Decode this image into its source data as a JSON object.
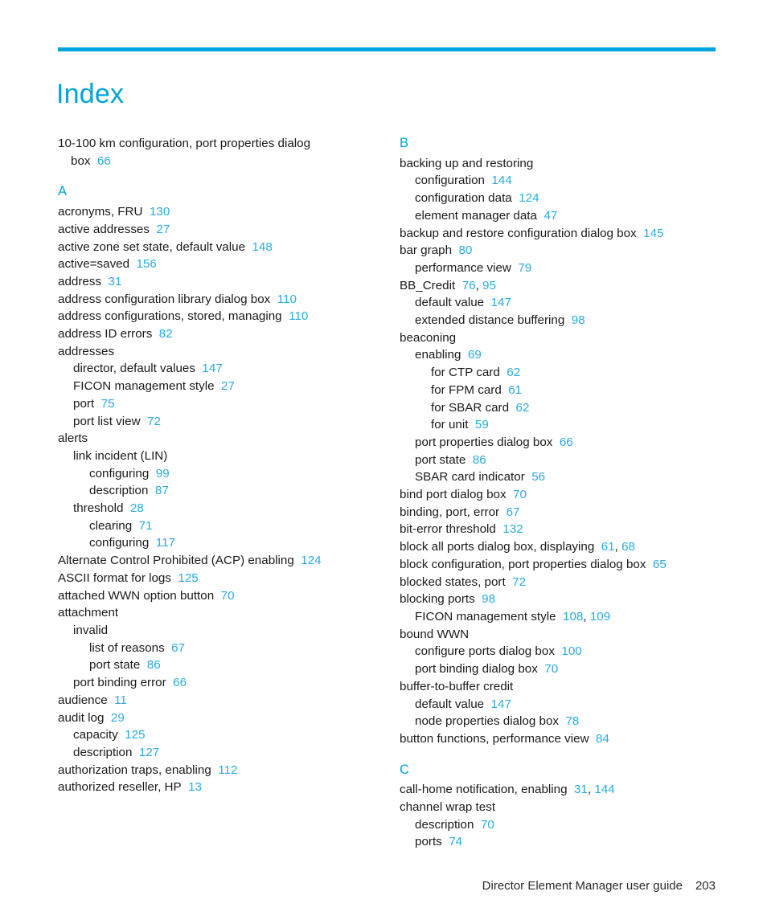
{
  "document": {
    "title": "Index",
    "accent_color": "#00A3DE",
    "page_number_color": "#29ABE2",
    "text_color": "#1a1a1a"
  },
  "footer": {
    "guide_title": "Director Element Manager user guide",
    "folio": "203"
  },
  "columns": [
    {
      "name": "left-column",
      "blocks": [
        {
          "type": "entries",
          "letter": null,
          "entries": [
            {
              "level": 0,
              "text": "10-100 km configuration, port properties dialog",
              "pages": ""
            },
            {
              "level": 0,
              "continuation": true,
              "text": "box",
              "pages": "66"
            }
          ]
        },
        {
          "type": "entries",
          "letter": "A",
          "entries": [
            {
              "level": 0,
              "text": "acronyms, FRU",
              "pages": "130"
            },
            {
              "level": 0,
              "text": "active addresses",
              "pages": "27"
            },
            {
              "level": 0,
              "text": "active zone set state, default value",
              "pages": "148"
            },
            {
              "level": 0,
              "text": "active=saved",
              "pages": "156"
            },
            {
              "level": 0,
              "text": "address",
              "pages": "31"
            },
            {
              "level": 0,
              "text": "address configuration library dialog box",
              "pages": "110"
            },
            {
              "level": 0,
              "text": "address configurations, stored, managing",
              "pages": "110"
            },
            {
              "level": 0,
              "text": "address ID errors",
              "pages": "82"
            },
            {
              "level": 0,
              "text": "addresses",
              "pages": ""
            },
            {
              "level": 1,
              "text": "director, default values",
              "pages": "147"
            },
            {
              "level": 1,
              "text": "FICON management style",
              "pages": "27"
            },
            {
              "level": 1,
              "text": "port",
              "pages": "75"
            },
            {
              "level": 1,
              "text": "port list view",
              "pages": "72"
            },
            {
              "level": 0,
              "text": "alerts",
              "pages": ""
            },
            {
              "level": 1,
              "text": "link incident (LIN)",
              "pages": ""
            },
            {
              "level": 2,
              "text": "configuring",
              "pages": "99"
            },
            {
              "level": 2,
              "text": "description",
              "pages": "87"
            },
            {
              "level": 1,
              "text": "threshold",
              "pages": "28"
            },
            {
              "level": 2,
              "text": "clearing",
              "pages": "71"
            },
            {
              "level": 2,
              "text": "configuring",
              "pages": "117"
            },
            {
              "level": 0,
              "text": "Alternate Control Prohibited (ACP) enabling",
              "pages": "124"
            },
            {
              "level": 0,
              "text": "ASCII format for logs",
              "pages": "125"
            },
            {
              "level": 0,
              "text": "attached WWN option button",
              "pages": "70"
            },
            {
              "level": 0,
              "text": "attachment",
              "pages": ""
            },
            {
              "level": 1,
              "text": "invalid",
              "pages": ""
            },
            {
              "level": 2,
              "text": "list of reasons",
              "pages": "67"
            },
            {
              "level": 2,
              "text": "port state",
              "pages": "86"
            },
            {
              "level": 1,
              "text": "port binding error",
              "pages": "66"
            },
            {
              "level": 0,
              "text": "audience",
              "pages": "11"
            },
            {
              "level": 0,
              "text": "audit log",
              "pages": "29"
            },
            {
              "level": 1,
              "text": "capacity",
              "pages": "125"
            },
            {
              "level": 1,
              "text": "description",
              "pages": "127"
            },
            {
              "level": 0,
              "text": "authorization traps, enabling",
              "pages": "112"
            },
            {
              "level": 0,
              "text": "authorized reseller, HP",
              "pages": "13"
            }
          ]
        }
      ]
    },
    {
      "name": "right-column",
      "blocks": [
        {
          "type": "entries",
          "letter": "B",
          "entries": [
            {
              "level": 0,
              "text": "backing up and restoring",
              "pages": ""
            },
            {
              "level": 1,
              "text": "configuration",
              "pages": "144"
            },
            {
              "level": 1,
              "text": "configuration data",
              "pages": "124"
            },
            {
              "level": 1,
              "text": "element manager data",
              "pages": "47"
            },
            {
              "level": 0,
              "text": "backup and restore configuration dialog box",
              "pages": "145"
            },
            {
              "level": 0,
              "text": "bar graph",
              "pages": "80"
            },
            {
              "level": 1,
              "text": "performance view",
              "pages": "79"
            },
            {
              "level": 0,
              "text": "BB_Credit",
              "pages": "76, 95"
            },
            {
              "level": 1,
              "text": "default value",
              "pages": "147"
            },
            {
              "level": 1,
              "text": "extended distance buffering",
              "pages": "98"
            },
            {
              "level": 0,
              "text": "beaconing",
              "pages": ""
            },
            {
              "level": 1,
              "text": "enabling",
              "pages": "69"
            },
            {
              "level": 2,
              "text": "for CTP card",
              "pages": "62"
            },
            {
              "level": 2,
              "text": "for FPM card",
              "pages": "61"
            },
            {
              "level": 2,
              "text": "for SBAR card",
              "pages": "62"
            },
            {
              "level": 2,
              "text": "for unit",
              "pages": "59"
            },
            {
              "level": 1,
              "text": "port properties dialog box",
              "pages": "66"
            },
            {
              "level": 1,
              "text": "port state",
              "pages": "86"
            },
            {
              "level": 1,
              "text": "SBAR card indicator",
              "pages": "56"
            },
            {
              "level": 0,
              "text": "bind port dialog box",
              "pages": "70"
            },
            {
              "level": 0,
              "text": "binding, port, error",
              "pages": "67"
            },
            {
              "level": 0,
              "text": "bit-error threshold",
              "pages": "132"
            },
            {
              "level": 0,
              "text": "block all ports dialog box, displaying",
              "pages": "61, 68"
            },
            {
              "level": 0,
              "text": "block configuration, port properties dialog box",
              "pages": "65"
            },
            {
              "level": 0,
              "text": "blocked states, port",
              "pages": "72"
            },
            {
              "level": 0,
              "text": "blocking ports",
              "pages": "98"
            },
            {
              "level": 1,
              "text": "FICON management style",
              "pages": "108, 109"
            },
            {
              "level": 0,
              "text": "bound WWN",
              "pages": ""
            },
            {
              "level": 1,
              "text": "configure ports dialog box",
              "pages": "100"
            },
            {
              "level": 1,
              "text": "port binding dialog box",
              "pages": "70"
            },
            {
              "level": 0,
              "text": "buffer-to-buffer credit",
              "pages": ""
            },
            {
              "level": 1,
              "text": "default value",
              "pages": "147"
            },
            {
              "level": 1,
              "text": "node properties dialog box",
              "pages": "78"
            },
            {
              "level": 0,
              "text": "button functions, performance view",
              "pages": "84"
            }
          ]
        },
        {
          "type": "entries",
          "letter": "C",
          "entries": [
            {
              "level": 0,
              "text": "call-home notification, enabling",
              "pages": "31, 144"
            },
            {
              "level": 0,
              "text": "channel wrap test",
              "pages": ""
            },
            {
              "level": 1,
              "text": "description",
              "pages": "70"
            },
            {
              "level": 1,
              "text": "ports",
              "pages": "74"
            }
          ]
        }
      ]
    }
  ]
}
